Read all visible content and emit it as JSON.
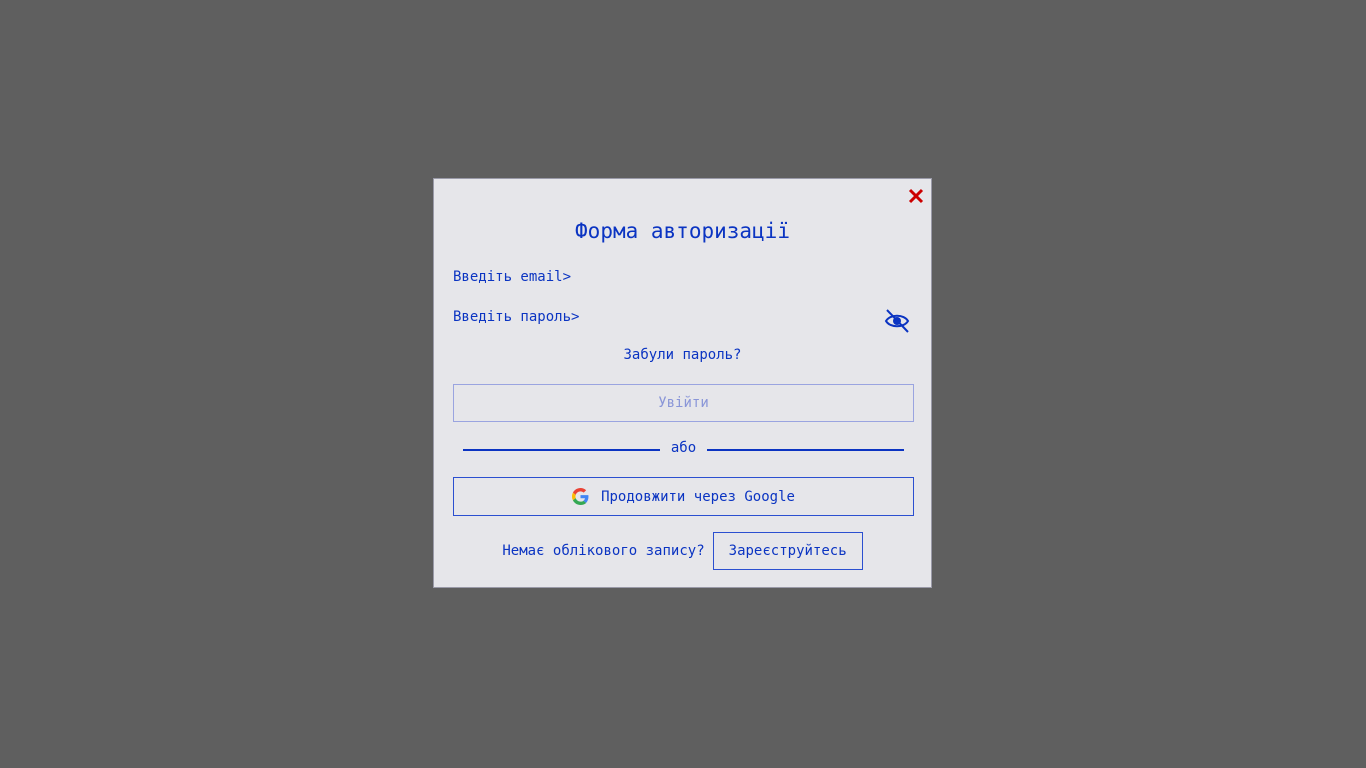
{
  "modal": {
    "title": "Форма авторизації",
    "close_icon": "close-icon",
    "email": {
      "placeholder": "Введіть email>",
      "value": ""
    },
    "password": {
      "placeholder": "Введіть пароль>",
      "value": "",
      "toggle_icon": "eye-slash-icon"
    },
    "forgot_password_label": "Забули пароль?",
    "login_button_label": "Увійти",
    "divider_label": "або",
    "google_button": {
      "label": "Продовжити через Google",
      "icon": "google-icon"
    },
    "signup": {
      "prompt": "Немає облікового запису?",
      "button_label": "Зареєструйтесь"
    }
  },
  "colors": {
    "overlay": "#5f5f5f",
    "modal_bg": "#e6e6ea",
    "accent": "#0b34c2",
    "close": "#cc0000",
    "disabled_text": "#8a96d8"
  }
}
